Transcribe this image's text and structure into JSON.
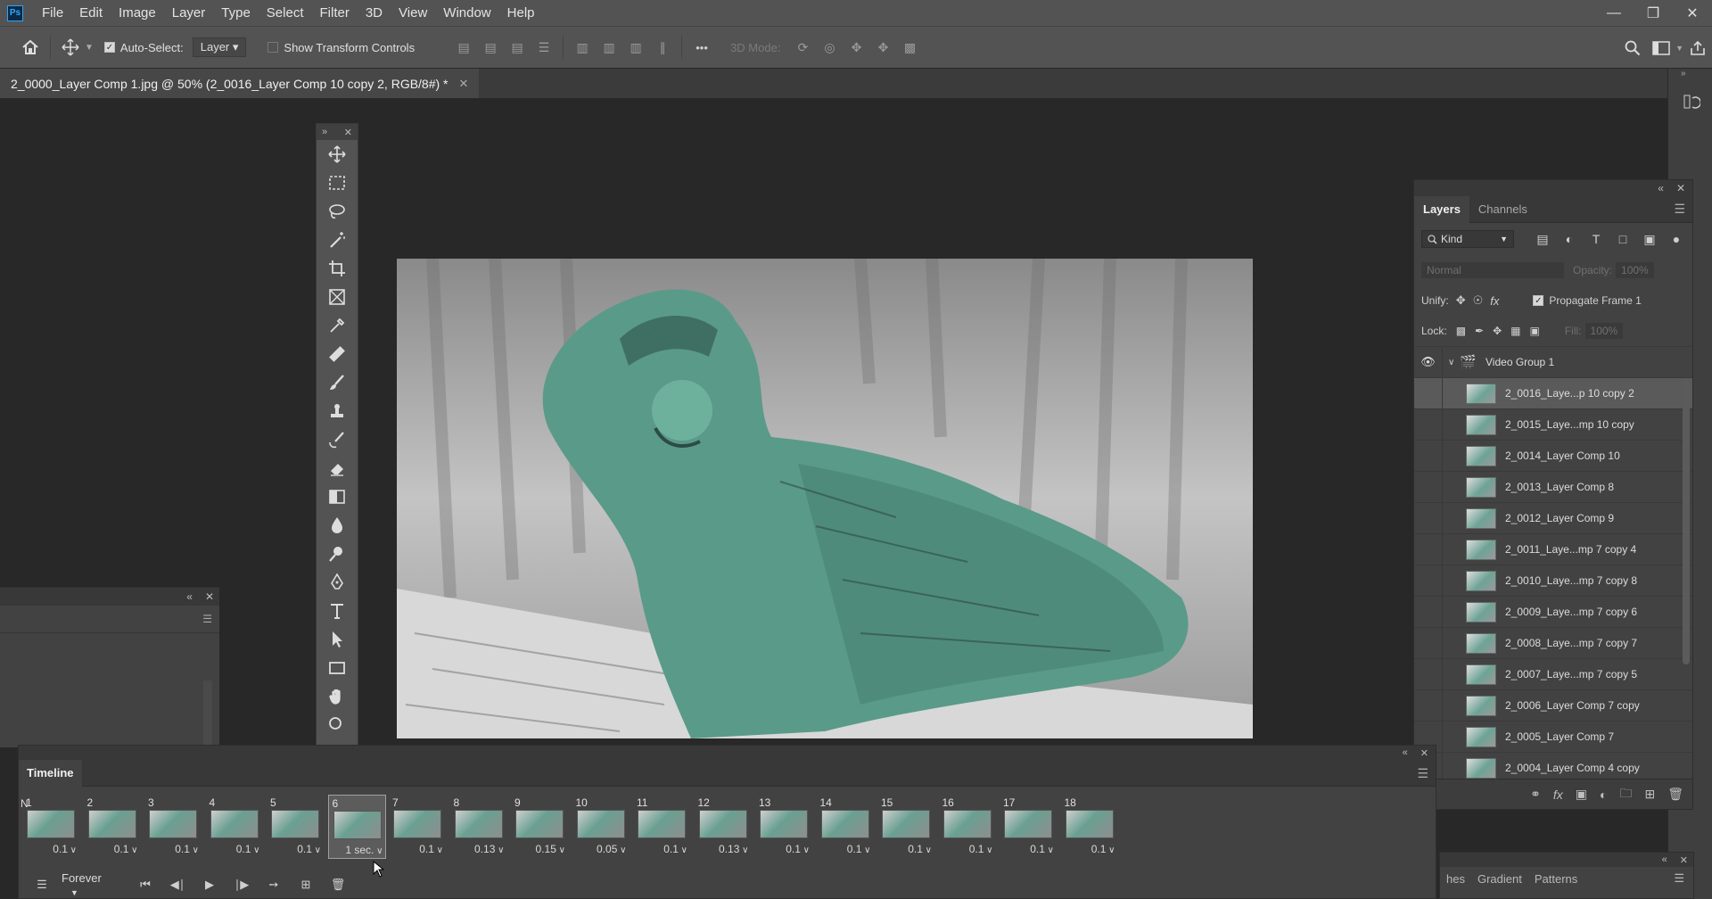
{
  "app": {
    "logo": "Ps",
    "menu": [
      "File",
      "Edit",
      "Image",
      "Layer",
      "Type",
      "Select",
      "Filter",
      "3D",
      "View",
      "Window",
      "Help"
    ]
  },
  "options_bar": {
    "auto_select_label": "Auto-Select:",
    "auto_select_target": "Layer",
    "transform_controls_label": "Show Transform Controls",
    "mode_3d_label": "3D Mode:",
    "more_label": "•••"
  },
  "document": {
    "tab_title": "2_0000_Layer Comp 1.jpg @ 50% (2_0016_Layer Comp 10 copy 2, RGB/8#) *"
  },
  "layers_panel": {
    "tabs": [
      "Layers",
      "Channels"
    ],
    "filter_kind": "Kind",
    "blend_mode": "Normal",
    "opacity_label": "Opacity:",
    "opacity_value": "100%",
    "unify_label": "Unify:",
    "propagate_label": "Propagate Frame 1",
    "lock_label": "Lock:",
    "fill_label": "Fill:",
    "fill_value": "100%",
    "group_name": "Video Group 1",
    "layers": [
      "2_0016_Laye...p 10 copy 2",
      "2_0015_Laye...mp 10 copy",
      "2_0014_Layer Comp 10",
      "2_0013_Layer Comp 8",
      "2_0012_Layer Comp 9",
      "2_0011_Laye...mp 7 copy 4",
      "2_0010_Laye...mp 7 copy 8",
      "2_0009_Laye...mp 7 copy 6",
      "2_0008_Laye...mp 7 copy 7",
      "2_0007_Laye...mp 7 copy 5",
      "2_0006_Layer Comp 7 copy",
      "2_0005_Layer Comp 7",
      "2_0004_Layer Comp 4 copy"
    ],
    "selected_layer_index": 0
  },
  "gradient_panel": {
    "tabs": [
      "hes",
      "Gradient",
      "Patterns"
    ]
  },
  "timeline": {
    "title": "Timeline",
    "loop": "Forever",
    "selected_frame_index": 5,
    "frames": [
      {
        "num": "1",
        "delay": "0.1"
      },
      {
        "num": "2",
        "delay": "0.1"
      },
      {
        "num": "3",
        "delay": "0.1"
      },
      {
        "num": "4",
        "delay": "0.1"
      },
      {
        "num": "5",
        "delay": "0.1"
      },
      {
        "num": "6",
        "delay": "1 sec."
      },
      {
        "num": "7",
        "delay": "0.1"
      },
      {
        "num": "8",
        "delay": "0.13"
      },
      {
        "num": "9",
        "delay": "0.15"
      },
      {
        "num": "10",
        "delay": "0.05"
      },
      {
        "num": "11",
        "delay": "0.1"
      },
      {
        "num": "12",
        "delay": "0.13"
      },
      {
        "num": "13",
        "delay": "0.1"
      },
      {
        "num": "14",
        "delay": "0.1"
      },
      {
        "num": "15",
        "delay": "0.1"
      },
      {
        "num": "16",
        "delay": "0.1"
      },
      {
        "num": "17",
        "delay": "0.1"
      },
      {
        "num": "18",
        "delay": "0.1"
      }
    ]
  },
  "colors": {
    "menubar_bg": "#535353",
    "workspace_bg": "#282828",
    "panel_bg": "#424242",
    "art_teal": "#5a9a88"
  }
}
